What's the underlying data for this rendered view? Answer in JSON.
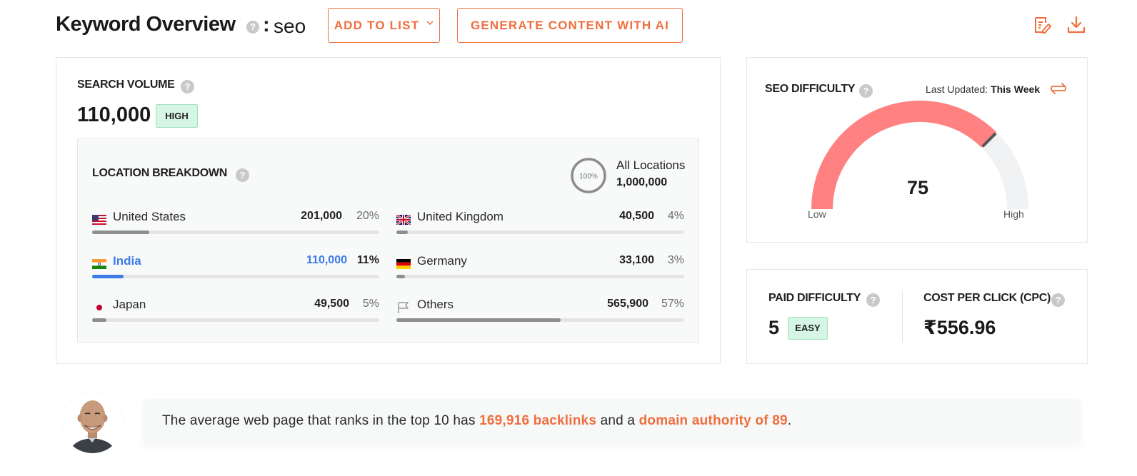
{
  "header": {
    "title": "Keyword Overview",
    "help": "?",
    "colon": ":",
    "keyword": "seo",
    "add_to_list_label": "ADD TO LIST",
    "generate_label": "GENERATE CONTENT WITH AI",
    "icons": [
      "edit-report-icon",
      "download-icon"
    ],
    "accent_color": "#ef6e3e"
  },
  "search_volume": {
    "label": "SEARCH VOLUME",
    "value": "110,000",
    "badge": "HIGH"
  },
  "location_breakdown": {
    "label": "LOCATION BREAKDOWN",
    "ring_label": "100%",
    "ring_fraction": 1.0,
    "all_locations_label": "All Locations",
    "all_locations_value": "1,000,000",
    "locations": [
      {
        "name": "United States",
        "count": "201,000",
        "pct": "20%",
        "fraction": 0.2,
        "flag": "us-flag-icon"
      },
      {
        "name": "United Kingdom",
        "count": "40,500",
        "pct": "4%",
        "fraction": 0.04,
        "flag": "uk-flag-icon"
      },
      {
        "name": "India",
        "count": "110,000",
        "pct": "11%",
        "fraction": 0.11,
        "flag": "india-flag-icon",
        "active": true
      },
      {
        "name": "Germany",
        "count": "33,100",
        "pct": "3%",
        "fraction": 0.03,
        "flag": "germany-flag-icon"
      },
      {
        "name": "Japan",
        "count": "49,500",
        "pct": "5%",
        "fraction": 0.05,
        "flag": "japan-flag-icon"
      },
      {
        "name": "Others",
        "count": "565,900",
        "pct": "57%",
        "fraction": 0.57,
        "flag": "flag-outline-icon"
      }
    ]
  },
  "seo_difficulty": {
    "label": "SEO DIFFICULTY",
    "updated_prefix": "Last Updated:",
    "updated_value": "This Week",
    "value": "75",
    "fraction": 0.75,
    "low_label": "Low",
    "high_label": "High",
    "gauge_color": "#ff8181",
    "track_color": "#f1f2f3"
  },
  "paid_difficulty": {
    "label": "PAID DIFFICULTY",
    "value": "5",
    "badge": "EASY"
  },
  "cpc": {
    "label": "COST PER CLICK (CPC)",
    "value": "₹556.96"
  },
  "banner": {
    "text_1": "The average web page that ranks in the top 10 has ",
    "highlight_1": "169,916 backlinks",
    "text_2": " and a ",
    "highlight_2": "domain authority of 89",
    "text_3": "."
  }
}
